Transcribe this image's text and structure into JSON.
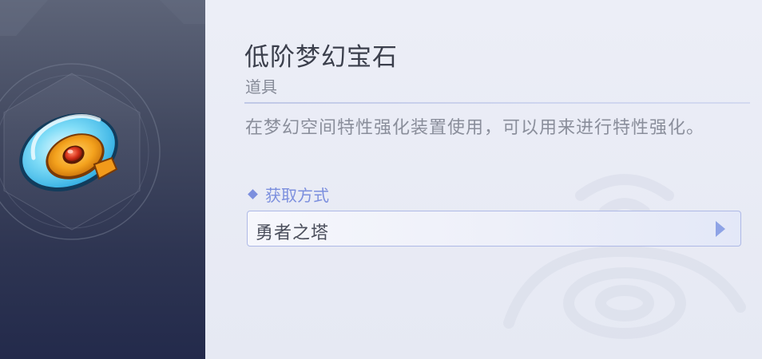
{
  "item": {
    "name": "低阶梦幻宝石",
    "type": "道具",
    "description": "在梦幻空间特性强化装置使用，可以用来进行特性强化。",
    "icon": "dream-gem-icon"
  },
  "source": {
    "header": "获取方式",
    "entries": [
      {
        "label": "勇者之塔",
        "icon": "arrow-right-icon"
      }
    ]
  },
  "colors": {
    "left_panel_top": "#5d6478",
    "left_panel_bottom": "#232a4b",
    "content_bg": "#e9ecf5",
    "title_text": "#3b3f4c",
    "secondary_text": "#868b98",
    "accent": "#7c8fde",
    "row_border": "#aeb9e6"
  }
}
